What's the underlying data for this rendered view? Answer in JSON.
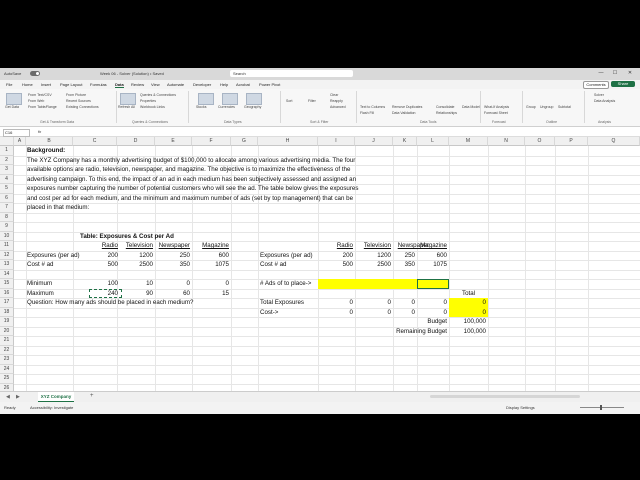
{
  "titlebar": {
    "autosave": "AutoSave",
    "title": "Week 06 - Solver (Solution) • Saved",
    "search": "Search",
    "min": "—",
    "max": "☐",
    "close": "✕"
  },
  "menu": {
    "items": [
      "File",
      "Home",
      "Insert",
      "Page Layout",
      "Formulas",
      "Data",
      "Review",
      "View",
      "Automate",
      "Developer",
      "Help",
      "Acrobat",
      "Power Pivot"
    ],
    "active_index": 5,
    "comments": "Comments",
    "share": "Share"
  },
  "ribbon": {
    "small_items": [
      "From Text/CSV",
      "From Web",
      "From Table/Range",
      "From Picture",
      "Recent Sources",
      "Existing Connections",
      "Queries & Connections",
      "Properties",
      "Workbook Links",
      "Stocks",
      "Currencies",
      "Geography",
      "Sort",
      "Filter",
      "Clear",
      "Reapply",
      "Advanced",
      "Text to Columns",
      "Flash Fill",
      "Remove Duplicates",
      "Data Validation",
      "Consolidate",
      "Relationships",
      "Data Model",
      "What-If Analysis",
      "Forecast Sheet",
      "Group",
      "Ungroup",
      "Subtotal",
      "Solver",
      "Data Analysis"
    ],
    "groups": [
      "Get & Transform Data",
      "Queries & Connections",
      "Data Types",
      "Sort & Filter",
      "Data Tools",
      "Forecast",
      "Outline",
      "Analysis"
    ],
    "get_data": "Get Data",
    "refresh_all": "Refresh All"
  },
  "formula_bar": {
    "name_box": "C16",
    "fx": "fx",
    "content": ""
  },
  "columns": [
    "A",
    "B",
    "C",
    "D",
    "E",
    "F",
    "G",
    "H",
    "I",
    "J",
    "K",
    "L",
    "M",
    "N",
    "O",
    "P",
    "Q"
  ],
  "rows": [
    "1",
    "2",
    "3",
    "4",
    "5",
    "6",
    "7",
    "8",
    "9",
    "10",
    "11",
    "12",
    "13",
    "14",
    "15",
    "16",
    "17",
    "18",
    "19",
    "20",
    "21",
    "22",
    "23",
    "24",
    "25",
    "26"
  ],
  "background": {
    "heading": "Background:",
    "lines": [
      "The XYZ Company has a monthly advertising budget of $100,000 to allocate among various advertising media. The four",
      "available options are radio, television, newspaper, and magazine. The objective is to maximize the effectiveness of the",
      "advertising campaign. To this end, the impact of an ad in each medium has been subjectively assessed and assigned an",
      "exposures number capturing the number of potential customers who will see the ad. The table below gives the exposures",
      "and cost per ad for each medium, and the minimum and maximum number of ads (set by top management) that can be",
      "placed in that medium:"
    ]
  },
  "left_table": {
    "title": "Table: Exposures & Cost per Ad",
    "headers": [
      "Radio",
      "Television",
      "Newspaper",
      "Magazine"
    ],
    "rows": [
      {
        "label": "Exposures (per ad)",
        "values": [
          "200",
          "1200",
          "250",
          "600"
        ]
      },
      {
        "label": "Cost # ad",
        "values": [
          "500",
          "2500",
          "350",
          "1075"
        ]
      }
    ],
    "limits": [
      {
        "label": "Minimum",
        "values": [
          "100",
          "10",
          "0",
          "0"
        ]
      },
      {
        "label": "Maximum",
        "values": [
          "240",
          "90",
          "60",
          "15"
        ]
      }
    ],
    "question": "Question: How many ads should be placed in each medium?"
  },
  "right_table": {
    "headers": [
      "Radio",
      "Television",
      "Newspaper",
      "Magazine"
    ],
    "rows": [
      {
        "label": "Exposures (per ad)",
        "values": [
          "200",
          "1200",
          "250",
          "600"
        ]
      },
      {
        "label": "Cost # ad",
        "values": [
          "500",
          "2500",
          "350",
          "1075"
        ]
      }
    ],
    "ads_label": "# Ads of to place->",
    "total_header": "Total",
    "total_exposures_label": "Total Exposures",
    "total_exposures_values": [
      "0",
      "0",
      "0",
      "0"
    ],
    "total_exposures_total": "0",
    "cost_label": "Cost->",
    "cost_values": [
      "0",
      "0",
      "0",
      "0"
    ],
    "cost_total": "0",
    "budget_label": "Budget",
    "budget_value": "100,000",
    "remaining_label": "Remaining Budget",
    "remaining_value": "100,000"
  },
  "sheet_tabs": [
    "XYZ Company"
  ],
  "status": {
    "ready": "Ready",
    "accessibility": "Accessibility: Investigate",
    "display_settings": "Display Settings"
  },
  "colors": {
    "accent": "#1e7145",
    "highlight": "#ffff00"
  }
}
